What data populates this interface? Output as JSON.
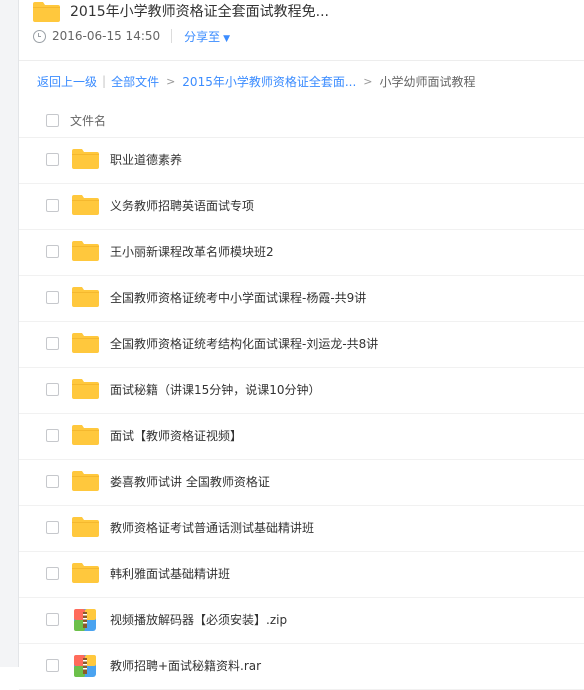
{
  "share": {
    "title": "2015年小学教师资格证全套面试教程免...",
    "time": "2016-06-15 14:50",
    "share_to": "分享至"
  },
  "breadcrumb": {
    "back": "返回上一级",
    "all_files": "全部文件",
    "parent": "2015年小学教师资格证全套面...",
    "current": "小学幼师面试教程"
  },
  "list": {
    "column_name": "文件名",
    "items": [
      {
        "name": "职业道德素养",
        "type": "folder"
      },
      {
        "name": "义务教师招聘英语面试专项",
        "type": "folder"
      },
      {
        "name": "王小丽新课程改革名师模块班2",
        "type": "folder"
      },
      {
        "name": "全国教师资格证统考中小学面试课程-杨霞-共9讲",
        "type": "folder"
      },
      {
        "name": "全国教师资格证统考结构化面试课程-刘运龙-共8讲",
        "type": "folder"
      },
      {
        "name": "面试秘籍（讲课15分钟，说课10分钟）",
        "type": "folder"
      },
      {
        "name": "面试【教师资格证视频】",
        "type": "folder"
      },
      {
        "name": "娄喜教师试讲 全国教师资格证",
        "type": "folder"
      },
      {
        "name": "教师资格证考试普通话测试基础精讲班",
        "type": "folder"
      },
      {
        "name": "韩利雅面试基础精讲班",
        "type": "folder"
      },
      {
        "name": "视频播放解码器【必须安装】.zip",
        "type": "archive"
      },
      {
        "name": "教师招聘+面试秘籍资料.rar",
        "type": "archive"
      }
    ]
  },
  "colors": {
    "link": "#3b8cff",
    "folder": "#ffc83d",
    "folder_tab": "#f5b82e"
  },
  "icons": [
    "folder-icon",
    "clock-icon",
    "chevron-down-icon",
    "archive-icon",
    "checkbox-icon"
  ]
}
